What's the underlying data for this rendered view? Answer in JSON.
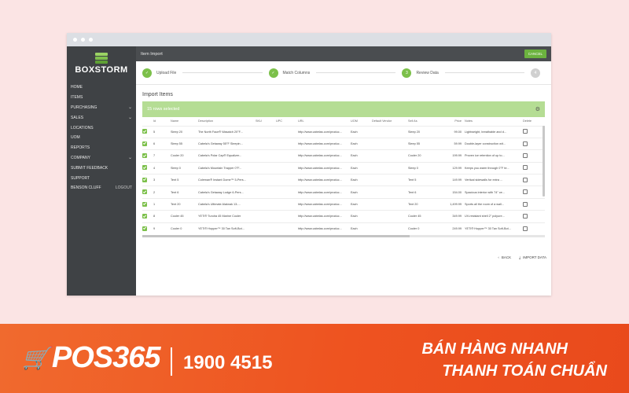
{
  "sidebar": {
    "brand": "BOXSTORM",
    "items": [
      {
        "label": "HOME",
        "chev": ""
      },
      {
        "label": "ITEMS",
        "chev": ""
      },
      {
        "label": "PURCHASING",
        "chev": "⌄"
      },
      {
        "label": "SALES",
        "chev": "⌄"
      },
      {
        "label": "LOCATIONS",
        "chev": ""
      },
      {
        "label": "UOM",
        "chev": ""
      },
      {
        "label": "REPORTS",
        "chev": ""
      },
      {
        "label": "COMPANY",
        "chev": "⌄"
      },
      {
        "label": "SUBMIT FEEDBACK",
        "chev": ""
      },
      {
        "label": "SUPPORT",
        "chev": ""
      },
      {
        "label": "BENSON CLUFF",
        "chev": "LOGOUT"
      }
    ]
  },
  "topbar": {
    "title": "Item Import",
    "cancel_label": "CANCEL"
  },
  "steps": [
    {
      "label": "Upload File",
      "state": "done",
      "num": "✓"
    },
    {
      "label": "Match Columns",
      "state": "done",
      "num": "✓"
    },
    {
      "label": "Review Data",
      "state": "active",
      "num": "3"
    },
    {
      "label": "",
      "state": "pending",
      "num": "4"
    }
  ],
  "section_title": "Import Items",
  "selection_text": "15 rows selected",
  "table": {
    "headers": [
      "",
      "Id",
      "Name",
      "Description",
      "SKU",
      "UPC",
      "URL",
      "UOM",
      "Default Vendor",
      "Sell As",
      "Price",
      "Notes",
      "Delete"
    ],
    "rows": [
      [
        "5",
        "Sleep 20",
        "The North Face® Wasatch 20°F...",
        "",
        "",
        "http://www.cabelas.com/produc...",
        "Each",
        "",
        "Sleep 20",
        "99.00",
        "Lightweight, breathable and d..."
      ],
      [
        "6",
        "Sleep 55",
        "Cabela's Getaway 55°F Sleepin...",
        "",
        "",
        "http://www.cabelas.com/produc...",
        "Each",
        "",
        "Sleep 55",
        "59.99",
        "Double-layer construction wit..."
      ],
      [
        "7",
        "Cooler 20",
        "Cabela's Polar Cap® Equalizer...",
        "",
        "",
        "http://www.cabelas.com/produc...",
        "Each",
        "",
        "Cooler 20",
        "199.99",
        "Proven ice retention of up to..."
      ],
      [
        "4",
        "Sleep 0",
        "Cabela's Mountain Trapper 0°F...",
        "",
        "",
        "http://www.cabelas.com/produc...",
        "Each",
        "",
        "Sleep 0",
        "129.99",
        "Keeps you warm through 0°F te..."
      ],
      [
        "3",
        "Tent 5",
        "Coleman® Instant Dome™ 5-Pers...",
        "",
        "",
        "http://www.cabelas.com/produc...",
        "Each",
        "",
        "Tent 5",
        "149.99",
        "Vertical sidewalls for extra ..."
      ],
      [
        "2",
        "Tent 6",
        "Cabela's Getaway Lodge 6-Pers...",
        "",
        "",
        "http://www.cabelas.com/produc...",
        "Each",
        "",
        "Tent 6",
        "154.00",
        "Spacious interior with 74\" ce..."
      ],
      [
        "1",
        "Tent 20",
        "Cabela's Ultimate Alaknak 13-...",
        "",
        "",
        "http://www.cabelas.com/produc...",
        "Each",
        "",
        "Tent 20",
        "1,499.99",
        "Sports all the room of a wall..."
      ],
      [
        "8",
        "Cooler 45",
        "YETI® Tundra 45 Marine Cooler",
        "",
        "",
        "http://www.cabelas.com/produc...",
        "Each",
        "",
        "Cooler 45",
        "349.99",
        "UV-resistant shell 2\" polyure..."
      ],
      [
        "9",
        "Cooler 0",
        "YETI® Hopper™ 30 Tan Soft-Bot...",
        "",
        "",
        "http://www.cabelas.com/produc...",
        "Each",
        "",
        "Cooler 0",
        "249.99",
        "YETI® Hopper™ 30 Tan Soft-Bot..."
      ]
    ]
  },
  "footer": {
    "back_label": "BACK",
    "import_label": "IMPORT DATA"
  },
  "banner": {
    "logo": "POS365",
    "hotline": "1900 4515",
    "slogan_line1": "BÁN HÀNG NHANH",
    "slogan_line2": "THANH TOÁN CHUẨN"
  }
}
